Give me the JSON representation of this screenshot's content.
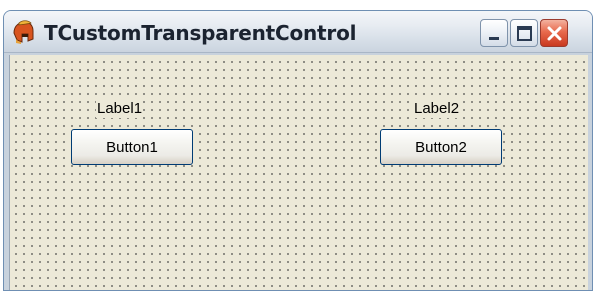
{
  "window": {
    "title": "TCustomTransparentControl",
    "controls": {
      "minimize": "minimize-icon",
      "maximize": "maximize-icon",
      "close": "close-icon"
    }
  },
  "form": {
    "grid": true,
    "labels": [
      "Label1",
      "Label2"
    ],
    "buttons": [
      "Button1",
      "Button2"
    ]
  },
  "colors": {
    "form_background": "#ece9d8",
    "titlebar": "#dde4ec",
    "close_button": "#e05a3c"
  }
}
